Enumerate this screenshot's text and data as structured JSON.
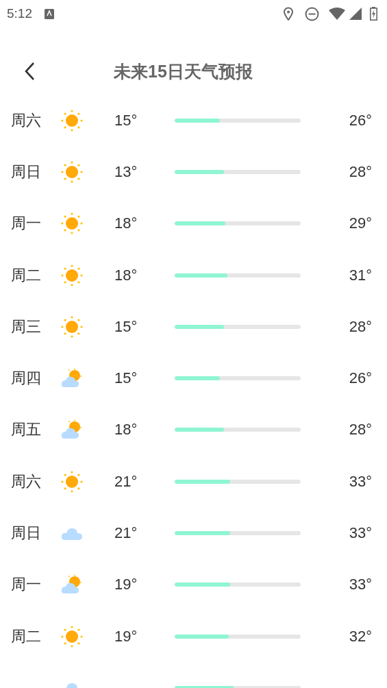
{
  "status_bar": {
    "time": "5:12"
  },
  "header": {
    "title": "未来15日天气预报"
  },
  "days": [
    {
      "day": "周六",
      "kind": "sunny",
      "low": "15°",
      "high": "26°",
      "level": 0.36
    },
    {
      "day": "周日",
      "kind": "sunny",
      "low": "13°",
      "high": "28°",
      "level": 0.39
    },
    {
      "day": "周一",
      "kind": "sunny",
      "low": "18°",
      "high": "29°",
      "level": 0.4
    },
    {
      "day": "周二",
      "kind": "sunny",
      "low": "18°",
      "high": "31°",
      "level": 0.42
    },
    {
      "day": "周三",
      "kind": "sunny",
      "low": "15°",
      "high": "28°",
      "level": 0.39
    },
    {
      "day": "周四",
      "kind": "partly-cloudy",
      "low": "15°",
      "high": "26°",
      "level": 0.36
    },
    {
      "day": "周五",
      "kind": "partly-cloudy",
      "low": "18°",
      "high": "28°",
      "level": 0.39
    },
    {
      "day": "周六",
      "kind": "sunny",
      "low": "21°",
      "high": "33°",
      "level": 0.44
    },
    {
      "day": "周日",
      "kind": "cloudy",
      "low": "21°",
      "high": "33°",
      "level": 0.44
    },
    {
      "day": "周一",
      "kind": "partly-cloudy",
      "low": "19°",
      "high": "33°",
      "level": 0.44
    },
    {
      "day": "周二",
      "kind": "sunny",
      "low": "19°",
      "high": "32°",
      "level": 0.43
    },
    {
      "kind": "cloudy",
      "level": 0.47
    }
  ]
}
